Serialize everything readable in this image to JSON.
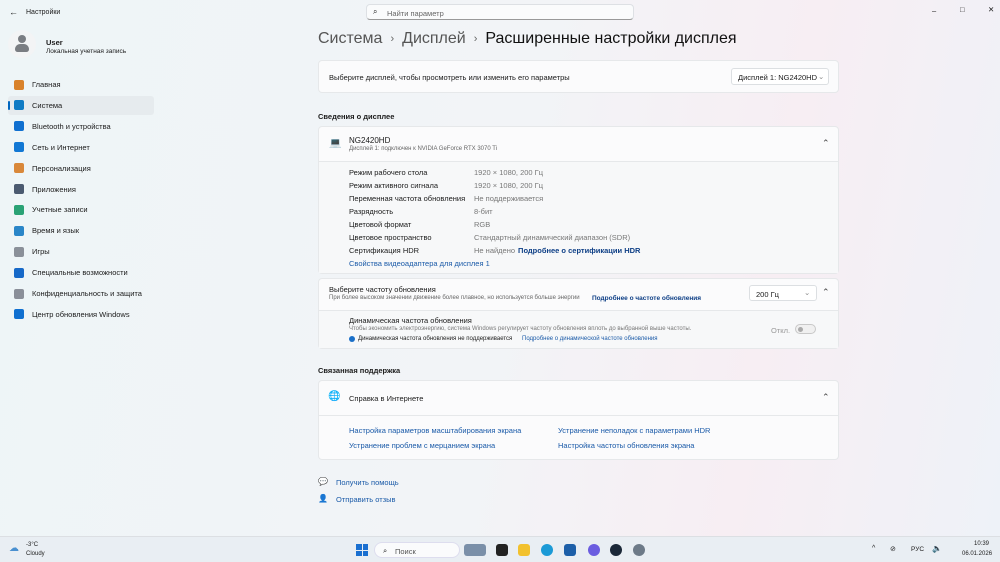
{
  "window": {
    "title": "Настройки",
    "search_placeholder": "Найти параметр",
    "controls": [
      "–",
      "□",
      "✕"
    ]
  },
  "user": {
    "name": "User",
    "account": "Локальная учетная запись"
  },
  "sidebar": {
    "items": [
      {
        "label": "Главная",
        "color": "#d9822b"
      },
      {
        "label": "Система",
        "color": "#0f7bc4",
        "selected": true
      },
      {
        "label": "Bluetooth и устройства",
        "color": "#1070d0"
      },
      {
        "label": "Сеть и Интернет",
        "color": "#1278d4"
      },
      {
        "label": "Персонализация",
        "color": "#d9883a"
      },
      {
        "label": "Приложения",
        "color": "#4b5a70"
      },
      {
        "label": "Учетные записи",
        "color": "#2aa275"
      },
      {
        "label": "Время и язык",
        "color": "#2a86c8"
      },
      {
        "label": "Игры",
        "color": "#8a9099"
      },
      {
        "label": "Специальные возможности",
        "color": "#1669c8"
      },
      {
        "label": "Конфиденциальность и защита",
        "color": "#8a8f99"
      },
      {
        "label": "Центр обновления Windows",
        "color": "#1070d0"
      }
    ]
  },
  "breadcrumb": [
    "Система",
    "Дисплей",
    "Расширенные настройки дисплея"
  ],
  "select_display": {
    "label": "Выберите дисплей, чтобы просмотреть или изменить его параметры",
    "value": "Дисплей 1: NG2420HD"
  },
  "display_info": {
    "section_title": "Сведения о дисплее",
    "name": "NG2420HD",
    "subtitle": "Дисплей 1: подключен к NVIDIA GeForce RTX 3070 Ti",
    "rows": [
      {
        "k": "Режим рабочего стола",
        "v": "1920 × 1080, 200 Гц"
      },
      {
        "k": "Режим активного сигнала",
        "v": "1920 × 1080, 200 Гц"
      },
      {
        "k": "Переменная частота обновления",
        "v": "Не поддерживается"
      },
      {
        "k": "Разрядность",
        "v": "8-бит"
      },
      {
        "k": "Цветовой формат",
        "v": "RGB"
      },
      {
        "k": "Цветовое пространство",
        "v": "Стандартный динамический диапазон (SDR)"
      }
    ],
    "hdr_label": "Сертификация HDR",
    "hdr_value": "Не найдено",
    "hdr_link": "Подробнее о сертификации HDR",
    "adapter_link": "Свойства видеоадаптера для дисплея 1"
  },
  "refresh": {
    "title": "Выберите частоту обновления",
    "desc": "При более высоком значении движение более плавное, но используется больше энергии",
    "link": "Подробнее о частоте обновления",
    "value": "200 Гц",
    "dynamic_title": "Динамическая частота обновления",
    "dynamic_desc": "Чтобы экономить электроэнергию, система Windows регулирует частоту обновления вплоть до выбранной выше частоты.",
    "dynamic_note": "Динамическая частота обновления не поддерживается",
    "dynamic_link": "Подробнее о динамической частоте обновления",
    "toggle_label": "Откл."
  },
  "support": {
    "section_title": "Связанная поддержка",
    "card_title": "Справка в Интернете",
    "links": [
      "Настройка параметров масштабирования экрана",
      "Устранение неполадок с параметрами HDR",
      "Устранение проблем с мерцанием экрана",
      "Настройка частоты обновления экрана"
    ]
  },
  "footer": {
    "help": "Получить помощь",
    "feedback": "Отправить отзыв"
  },
  "taskbar": {
    "temp": "-3°C",
    "weather": "Cloudy",
    "search": "Поиск",
    "lang": "РУС",
    "time": "10:39",
    "date": "06.01.2026"
  }
}
